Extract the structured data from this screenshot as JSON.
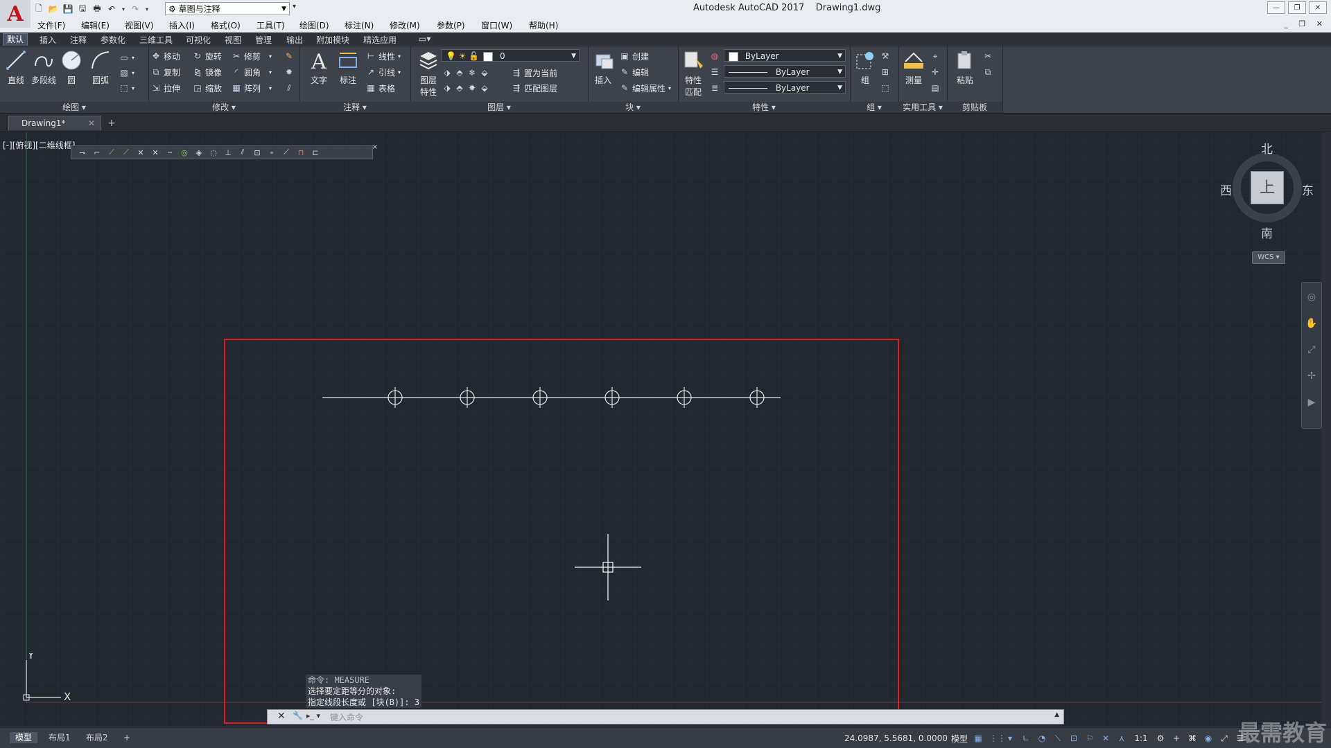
{
  "app": {
    "logo": "A",
    "title": "Autodesk AutoCAD 2017    Drawing1.dwg",
    "workspace": "草图与注释"
  },
  "menu": [
    "文件(F)",
    "编辑(E)",
    "视图(V)",
    "插入(I)",
    "格式(O)",
    "工具(T)",
    "绘图(D)",
    "标注(N)",
    "修改(M)",
    "参数(P)",
    "窗口(W)",
    "帮助(H)"
  ],
  "ribbon_tabs": [
    "默认",
    "插入",
    "注释",
    "参数化",
    "三维工具",
    "可视化",
    "视图",
    "管理",
    "输出",
    "附加模块",
    "精选应用"
  ],
  "panels": {
    "draw": {
      "label": "绘图",
      "tools": [
        "直线",
        "多段线",
        "圆",
        "圆弧"
      ]
    },
    "modify": {
      "label": "修改",
      "tools": [
        "移动",
        "旋转",
        "修剪",
        "复制",
        "镜像",
        "圆角",
        "拉伸",
        "缩放",
        "阵列"
      ]
    },
    "annotation": {
      "label": "注释",
      "big": [
        "文字",
        "标注"
      ],
      "tools": [
        "线性",
        "引线",
        "表格"
      ]
    },
    "layers": {
      "label": "图层",
      "big": "图层\n特性",
      "big_line1": "图层",
      "big_line2": "特性",
      "layer_value": "0",
      "tools": [
        "置为当前",
        "匹配图层"
      ]
    },
    "block": {
      "label": "块",
      "big": "插入",
      "tools": [
        "创建",
        "编辑",
        "编辑属性"
      ]
    },
    "properties": {
      "label": "特性",
      "big_line1": "特性",
      "big_line2": "匹配",
      "color": "ByLayer",
      "linetype": "ByLayer",
      "lineweight": "ByLayer"
    },
    "group": {
      "label": "组",
      "big": "组"
    },
    "utilities": {
      "label": "实用工具",
      "big": "测量"
    },
    "clipboard": {
      "label": "剪贴板",
      "big": "粘贴"
    }
  },
  "file_tab": {
    "name": "Drawing1*",
    "add": "+"
  },
  "viewport_label": "[-][俯视][二维线框]",
  "viewcube": {
    "north": "北",
    "south": "南",
    "east": "东",
    "west": "西",
    "face": "上",
    "wcs": "WCS"
  },
  "ucs": {
    "x": "X",
    "y": "Y"
  },
  "command": {
    "history": [
      "命令: MEASURE",
      "选择要定距等分的对象:",
      "指定线段长度或 [块(B)]: 3"
    ],
    "placeholder": "键入命令"
  },
  "layout_tabs": [
    "模型",
    "布局1",
    "布局2"
  ],
  "status": {
    "coords": "24.0987, 5.5681, 0.0000",
    "model": "模型",
    "scale": "1:1"
  },
  "watermark": "最需教育",
  "colors": {
    "canvas": "#212830",
    "highlight": "#e01b1b",
    "ribbon": "#3d424b"
  }
}
